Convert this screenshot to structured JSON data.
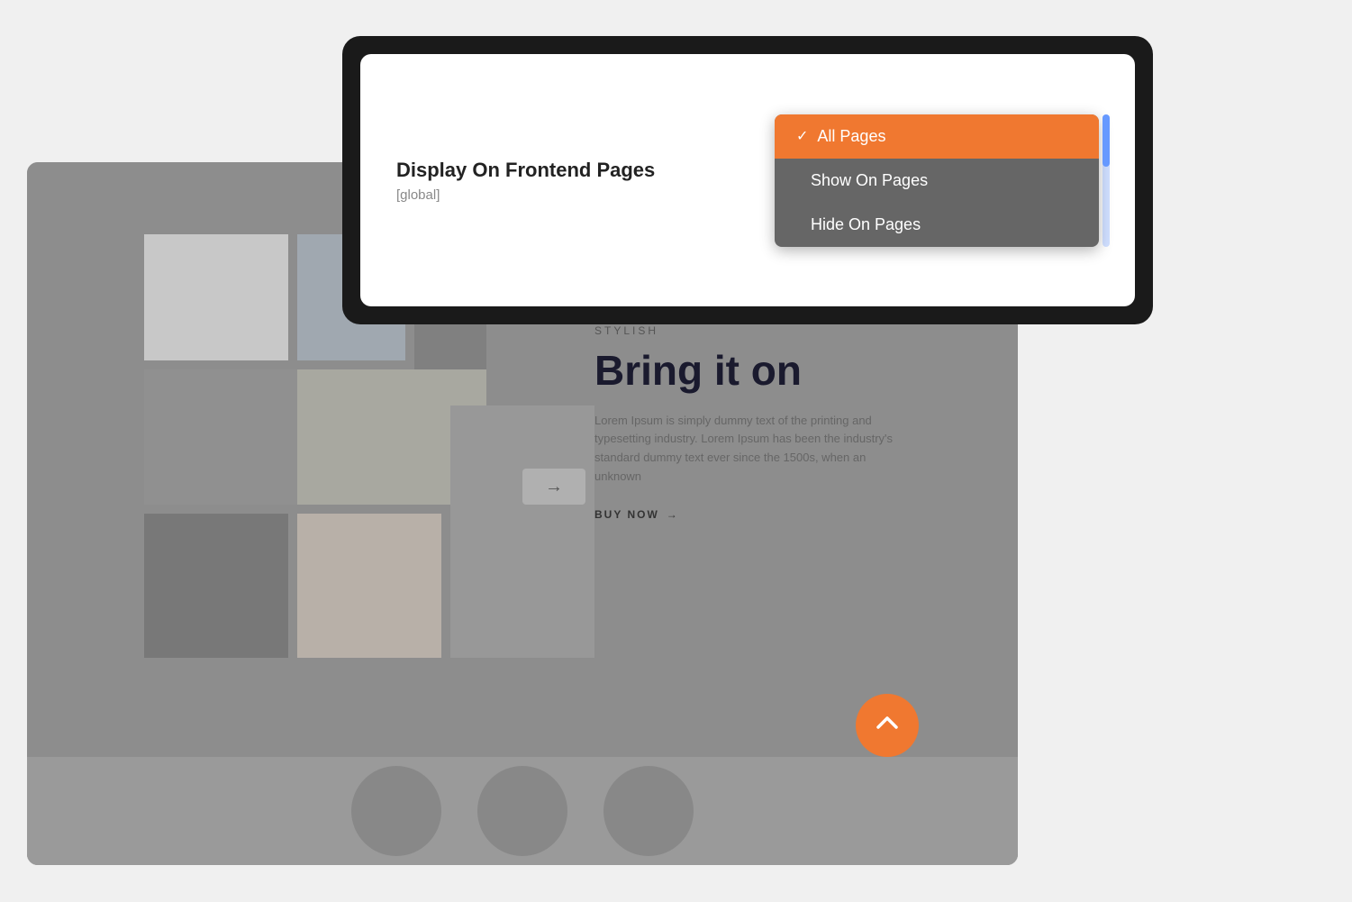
{
  "modal": {
    "title": "Display On Frontend Pages",
    "subtitle": "[global]"
  },
  "dropdown": {
    "options": [
      {
        "id": "all-pages",
        "label": "All Pages",
        "selected": true
      },
      {
        "id": "show-on-pages",
        "label": "Show On Pages",
        "selected": false
      },
      {
        "id": "hide-on-pages",
        "label": "Hide On Pages",
        "selected": false
      }
    ]
  },
  "website": {
    "stylish_label": "STYLISH",
    "heading": "Bring it on",
    "body_text": "Lorem Ipsum is simply dummy text of the printing and typesetting industry. Lorem Ipsum has been the industry's standard dummy text ever since the 1500s, when an unknown",
    "cta_label": "BUY NOW",
    "arrow": "→"
  },
  "scroll_top": {
    "icon": "chevron-up"
  }
}
